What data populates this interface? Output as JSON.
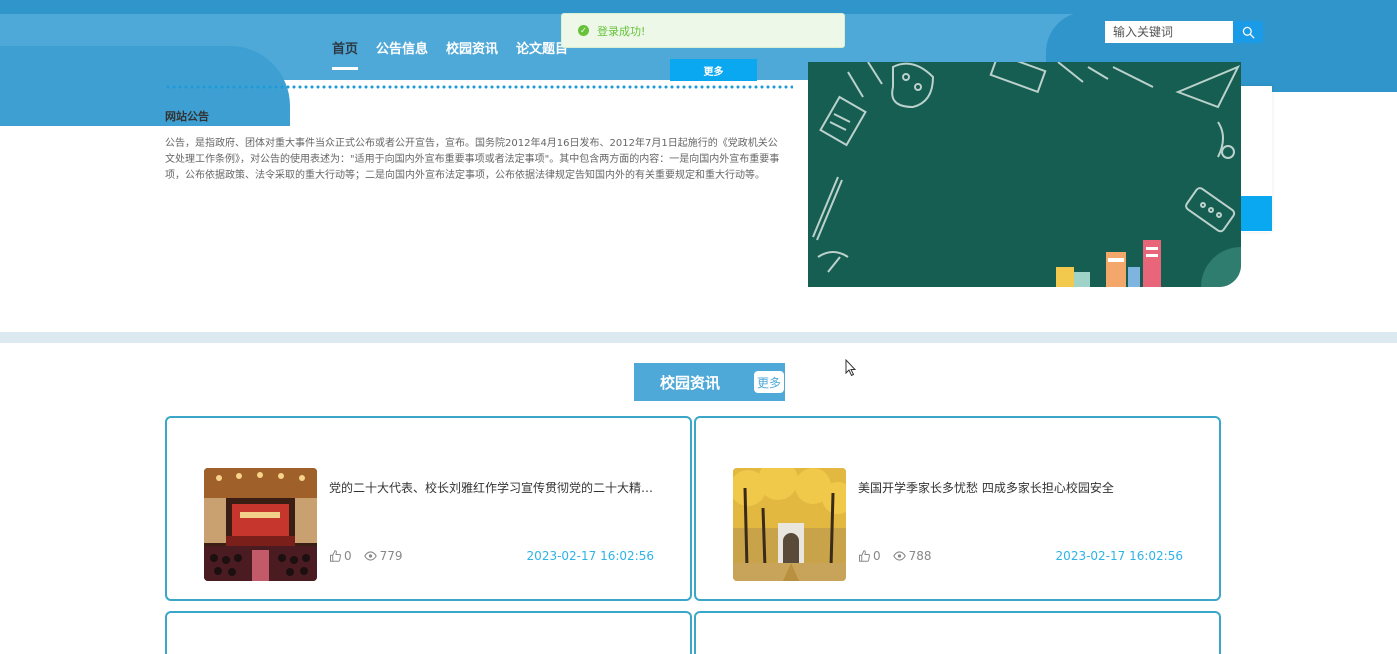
{
  "header": {
    "nav": [
      {
        "label": "首页",
        "active": true
      },
      {
        "label": "公告信息",
        "active": false
      },
      {
        "label": "校园资讯",
        "active": false
      },
      {
        "label": "论文题目",
        "active": false
      }
    ],
    "search_placeholder": "输入关键词",
    "search_icon": "search-icon",
    "colors": {
      "band": "#4fa9d8",
      "band_dark": "#2f95cb",
      "button": "#1a9be8"
    }
  },
  "toast": {
    "message": "登录成功!",
    "icon": "check-circle-icon",
    "color": "#67c23a"
  },
  "notice": {
    "more_label": "更多",
    "title": "网站公告",
    "body": "公告，是指政府、团体对重大事件当众正式公布或者公开宣告，宣布。国务院2012年4月16日发布、2012年7月1日起施行的《党政机关公文处理工作条例》，对公告的使用表述为：\"适用于向国内外宣布重要事项或者法定事项\"。其中包含两方面的内容：一是向国内外宣布重要事项，公布依据政策、法令采取的重大行动等；二是向国内外宣布法定事项，公布依据法律规定告知国内外的有关重要规定和重大行动等。"
  },
  "news": {
    "title": "校园资讯",
    "more_label": "更多",
    "cards": [
      {
        "title": "党的二十大代表、校长刘雅红作学习宣传贯彻党的二十大精神专题报告",
        "likes": "0",
        "views": "779",
        "date": "2023-02-17 16:02:56"
      },
      {
        "title": "美国开学季家长多忧愁 四成多家长担心校园安全",
        "likes": "0",
        "views": "788",
        "date": "2023-02-17 16:02:56"
      }
    ],
    "colors": {
      "border": "#3aa6c9",
      "date": "#2fb3e6"
    }
  }
}
